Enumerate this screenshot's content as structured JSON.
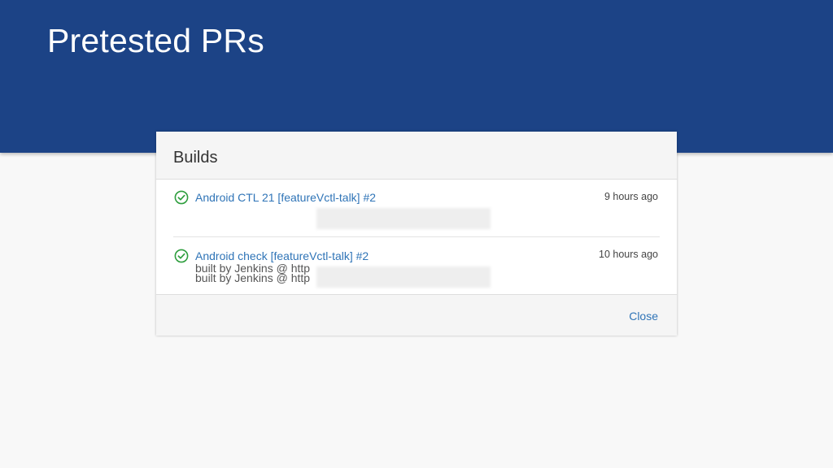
{
  "slide": {
    "title": "Pretested PRs"
  },
  "dialog": {
    "title": "Builds",
    "close_label": "Close",
    "builds": [
      {
        "name": "Android CTL 21 [featureVctl-talk] #2",
        "time": "9 hours ago",
        "built_by": "built by Jenkins @ http",
        "status": "success"
      },
      {
        "name": "Android check [featureVctl-talk] #2",
        "time": "10 hours ago",
        "built_by": "built by Jenkins @ http",
        "status": "success"
      }
    ]
  },
  "icons": {
    "status": "check-circle-icon"
  },
  "colors": {
    "header_band": "#1c4386",
    "link": "#2f74b7",
    "success": "#2e9e3e"
  }
}
